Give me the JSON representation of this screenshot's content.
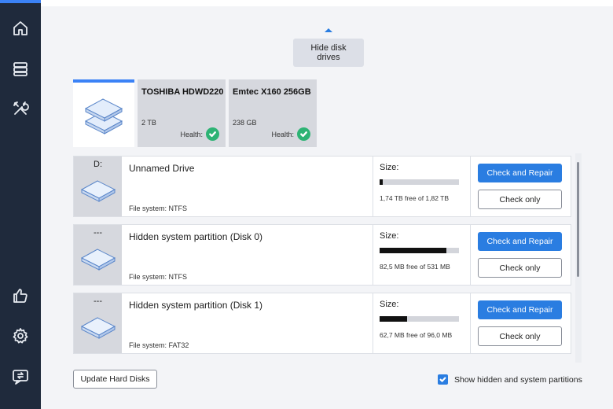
{
  "colors": {
    "accent": "#2a7de1",
    "sidebar": "#1f2a3c",
    "health_ok": "#2db374"
  },
  "sidebar": {
    "items": [
      {
        "icon": "home-icon"
      },
      {
        "icon": "storage-icon"
      },
      {
        "icon": "tools-icon"
      },
      {
        "icon": "thumbs-up-icon"
      },
      {
        "icon": "gear-icon"
      },
      {
        "icon": "feedback-icon"
      }
    ]
  },
  "header": {
    "hide_drives_label": "Hide disk drives"
  },
  "disks": [
    {
      "name": "TOSHIBA HDWD220",
      "size": "2 TB",
      "health_label": "Health:"
    },
    {
      "name": "Emtec X160 256GB",
      "size": "238 GB",
      "health_label": "Health:"
    }
  ],
  "partitions": [
    {
      "letter": "D:",
      "name": "Unnamed Drive",
      "fs": "File system: NTFS",
      "size_label": "Size:",
      "used_fraction": 0.04,
      "free": "1,74 TB free of 1,82 TB",
      "repair": "Check and Repair",
      "check": "Check only"
    },
    {
      "letter": "---",
      "name": "Hidden system partition (Disk 0)",
      "fs": "File system: NTFS",
      "size_label": "Size:",
      "used_fraction": 0.84,
      "free": "82,5 MB free of 531 MB",
      "repair": "Check and Repair",
      "check": "Check only"
    },
    {
      "letter": "---",
      "name": "Hidden system partition (Disk 1)",
      "fs": "File system: FAT32",
      "size_label": "Size:",
      "used_fraction": 0.35,
      "free": "62,7 MB free of 96,0 MB",
      "repair": "Check and Repair",
      "check": "Check only"
    }
  ],
  "footer": {
    "update_label": "Update Hard Disks",
    "show_hidden_label": "Show hidden and system partitions",
    "show_hidden_checked": true
  }
}
